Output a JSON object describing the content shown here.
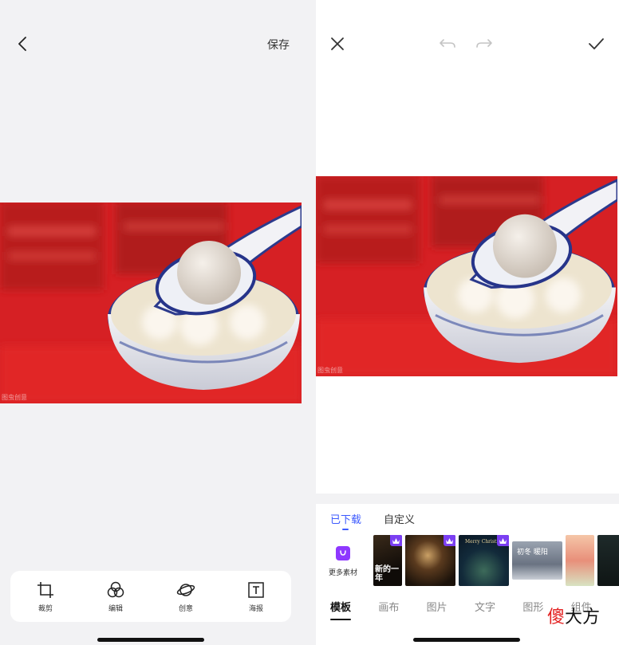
{
  "colors": {
    "accent": "#3d5afe",
    "crown": "#7b3ff2",
    "bag": "#8e38ff",
    "photo_red": "#cc1f20"
  },
  "left": {
    "back_icon": "chevron-left-icon",
    "save_label": "保存",
    "watermark": "图虫创意",
    "toolbar": [
      {
        "icon": "crop-icon",
        "label": "裁剪"
      },
      {
        "icon": "edit-circles-icon",
        "label": "编辑"
      },
      {
        "icon": "planet-icon",
        "label": "创意"
      },
      {
        "icon": "text-box-icon",
        "label": "海报"
      }
    ]
  },
  "right": {
    "close_icon": "close-icon",
    "undo_icon": "undo-icon",
    "redo_icon": "redo-icon",
    "confirm_icon": "check-icon",
    "watermark": "图虫创意",
    "subtabs": [
      "已下载",
      "自定义"
    ],
    "more_label": "更多素材",
    "thumbnails": [
      {
        "text": "新的一年",
        "premium": true
      },
      {
        "text": "",
        "premium": true
      },
      {
        "text": "Merry Christmas",
        "premium": true
      },
      {
        "text": "初冬 暖阳",
        "premium": false
      },
      {
        "text": "",
        "premium": false
      }
    ],
    "main_tabs": [
      "模板",
      "画布",
      "图片",
      "文字",
      "图形",
      "组件"
    ]
  },
  "brand": {
    "first_char": "傻",
    "rest": "大方"
  }
}
